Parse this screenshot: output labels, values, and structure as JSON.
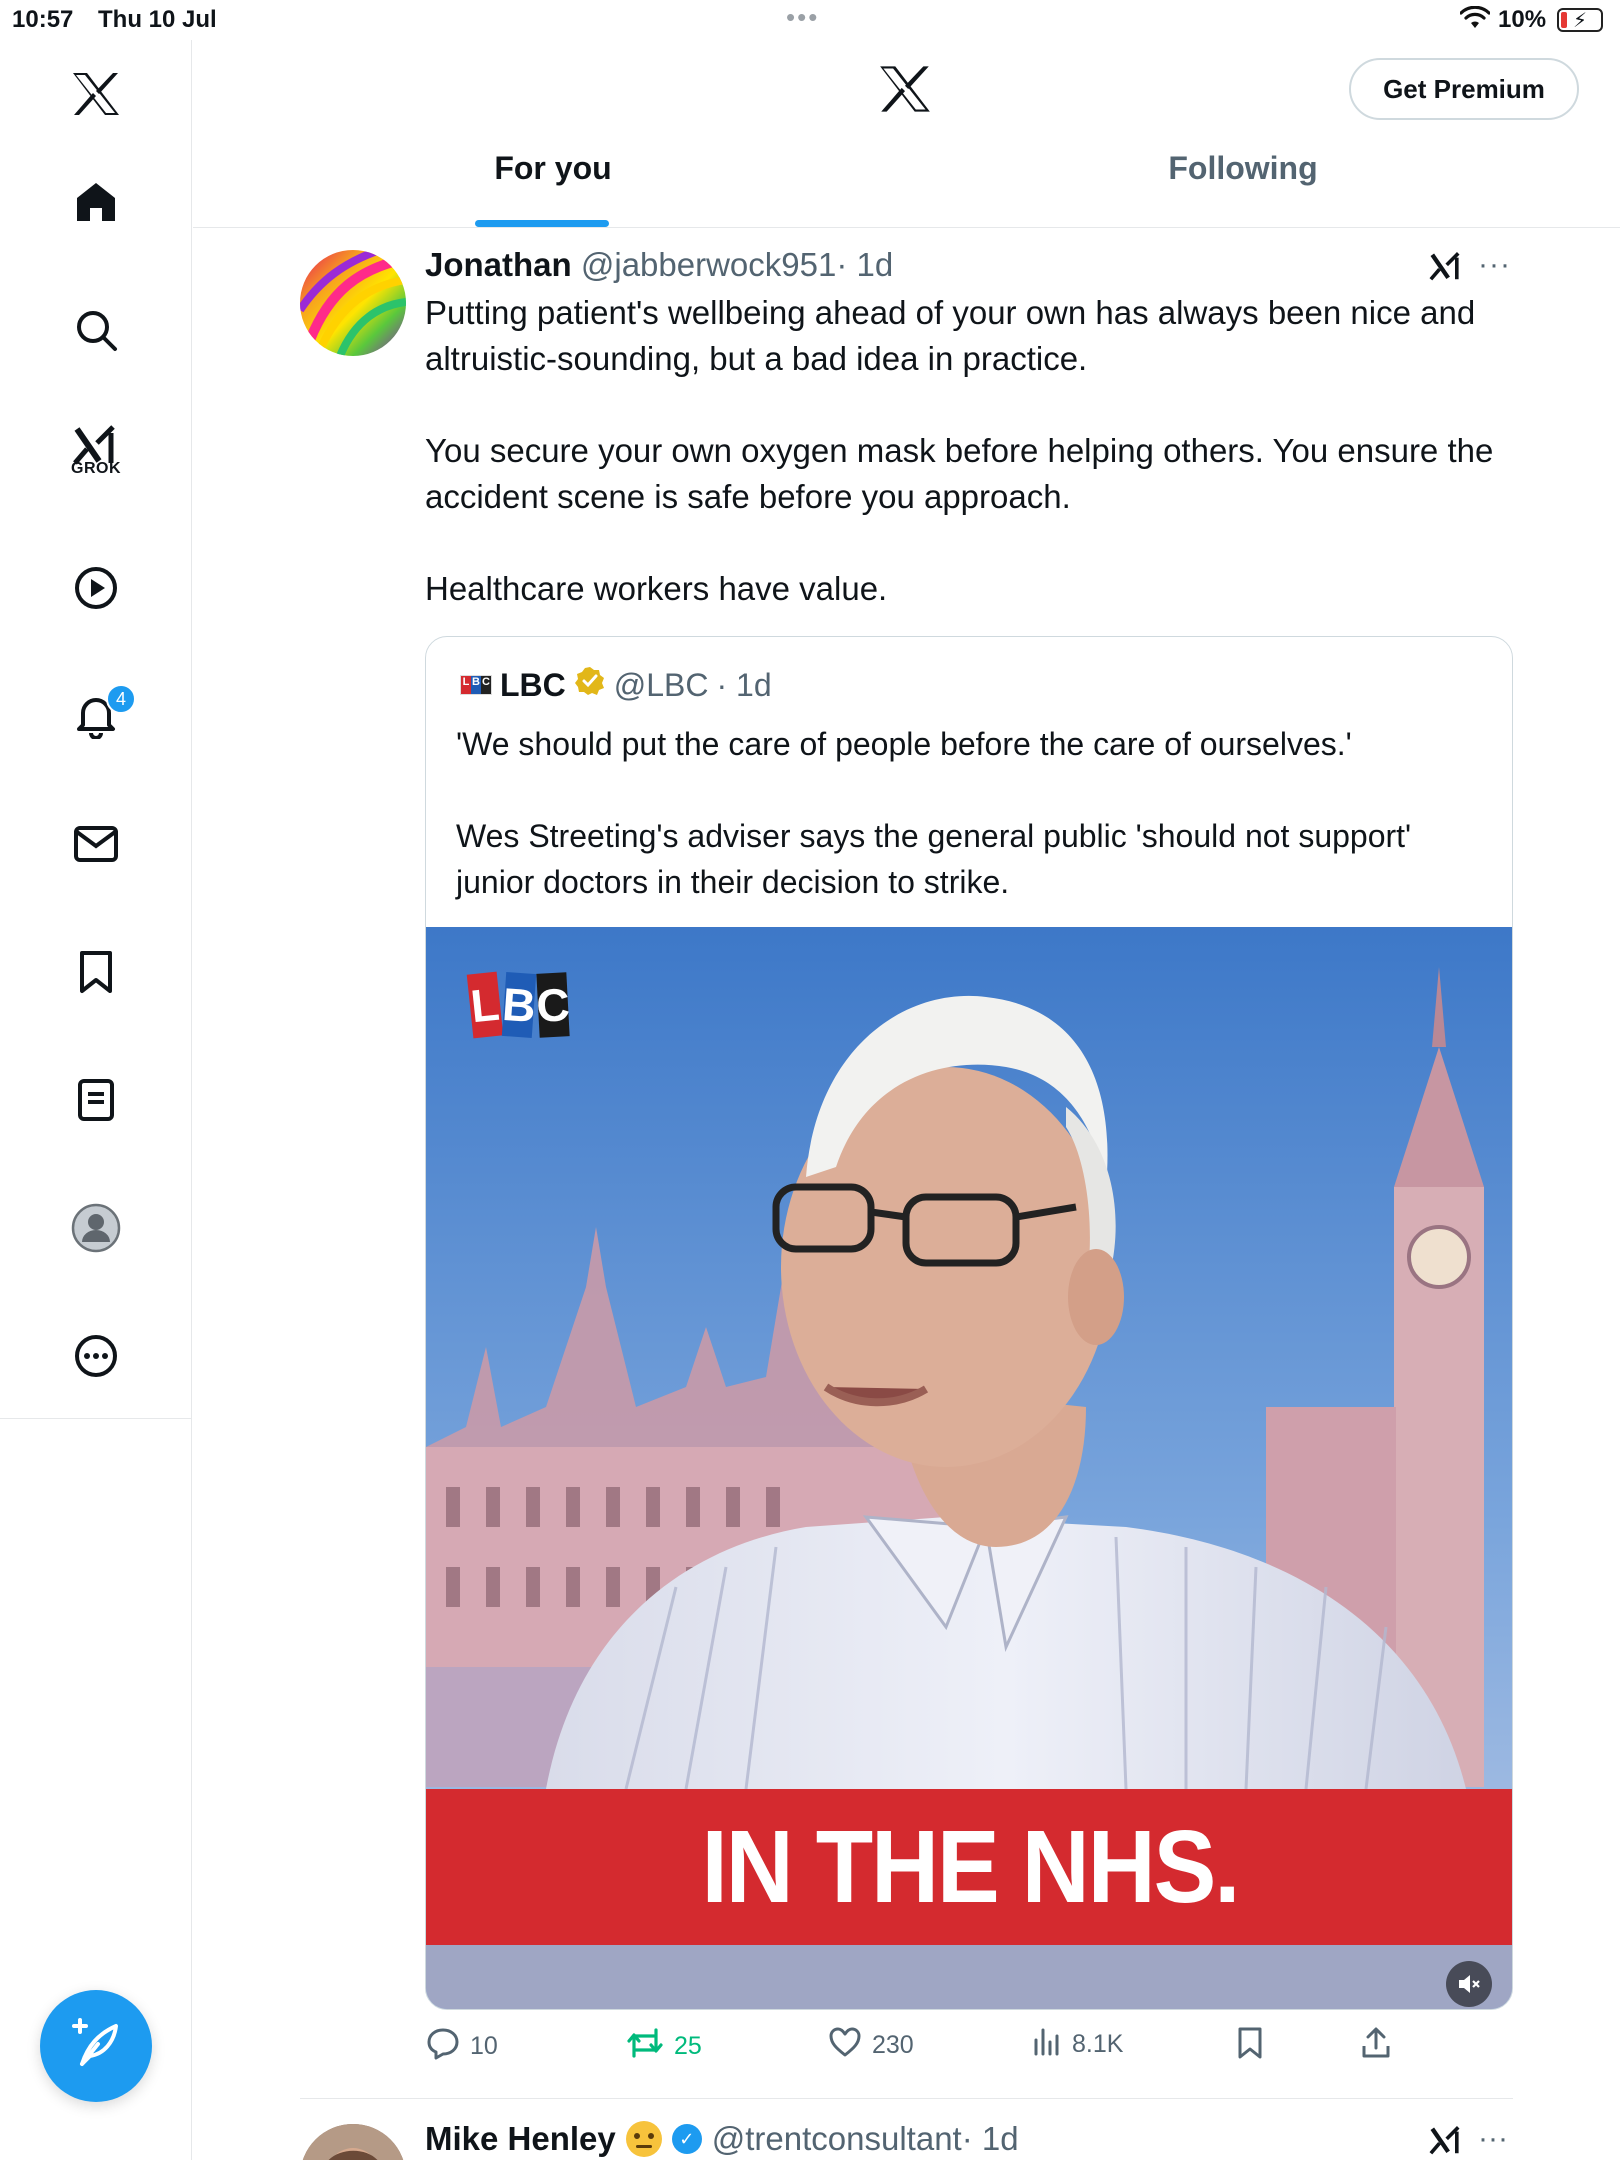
{
  "status_bar": {
    "time": "10:57",
    "date": "Thu 10 Jul",
    "battery_percent": "10%"
  },
  "sidebar": {
    "grok_label": "GROK",
    "notifications_badge": "4",
    "items": [
      {
        "name": "home",
        "icon": "home-icon"
      },
      {
        "name": "explore",
        "icon": "search-icon"
      },
      {
        "name": "grok",
        "icon": "grok-icon"
      },
      {
        "name": "video",
        "icon": "play-icon"
      },
      {
        "name": "notifications",
        "icon": "bell-icon"
      },
      {
        "name": "messages",
        "icon": "mail-icon"
      },
      {
        "name": "bookmarks",
        "icon": "bookmark-icon"
      },
      {
        "name": "lists",
        "icon": "list-icon"
      },
      {
        "name": "profile",
        "icon": "profile-icon"
      },
      {
        "name": "more",
        "icon": "more-icon"
      }
    ]
  },
  "header": {
    "premium_label": "Get Premium",
    "tabs": [
      {
        "label": "For you",
        "active": true
      },
      {
        "label": "Following",
        "active": false
      }
    ]
  },
  "tweet": {
    "name": "Jonathan",
    "handle": "@jabberwock951",
    "time": "· 1d",
    "paragraphs": [
      "Putting patient's wellbeing ahead of your own has always been nice and altruistic-sounding, but a bad idea in practice.",
      "You secure your own oxygen mask before helping others. You ensure the accident scene is safe before you approach.",
      "Healthcare workers have value."
    ],
    "quote": {
      "name": "LBC",
      "handle": "@LBC",
      "time": "· 1d",
      "paragraphs": [
        "'We should put the care of people before the care of ourselves.'",
        "Wes Streeting's adviser says the general public 'should not support' junior doctors in their decision to strike."
      ],
      "media_caption": "IN THE NHS.",
      "media_logo": [
        "L",
        "B",
        "C"
      ]
    },
    "stats": {
      "replies": "10",
      "reposts": "25",
      "likes": "230",
      "views": "8.1K"
    }
  },
  "next_tweet": {
    "name": "Mike Henley",
    "handle": "@trentconsultant",
    "time": "· 1d"
  },
  "colors": {
    "accent": "#1d9bf0",
    "repost": "#00ba7c",
    "caption_band": "#d42a2f"
  }
}
